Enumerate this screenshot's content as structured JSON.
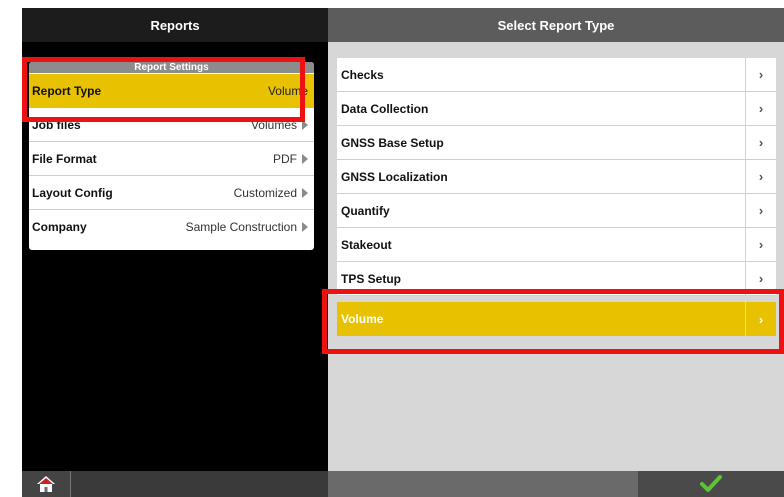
{
  "left_panel": {
    "title": "Reports",
    "settings_title": "Report Settings",
    "rows": [
      {
        "label": "Report Type",
        "value": "Volume"
      },
      {
        "label": "Job files",
        "value": "Volumes"
      },
      {
        "label": "File Format",
        "value": "PDF"
      },
      {
        "label": "Layout Config",
        "value": "Customized"
      },
      {
        "label": "Company",
        "value": "Sample Construction"
      }
    ]
  },
  "right_panel": {
    "title": "Select Report Type",
    "items": [
      {
        "label": "Checks"
      },
      {
        "label": "Data Collection"
      },
      {
        "label": "GNSS Base Setup"
      },
      {
        "label": "GNSS Localization"
      },
      {
        "label": "Quantify"
      },
      {
        "label": "Stakeout"
      },
      {
        "label": "TPS Setup"
      },
      {
        "label": "Volume"
      }
    ],
    "chevron": "›"
  },
  "colors": {
    "accent": "#e8c200",
    "highlight": "#ee1111",
    "confirm": "#5cc435"
  },
  "icons": {
    "home": "home-icon",
    "confirm": "checkmark-icon",
    "row_arrow": "triangle-right-icon"
  }
}
